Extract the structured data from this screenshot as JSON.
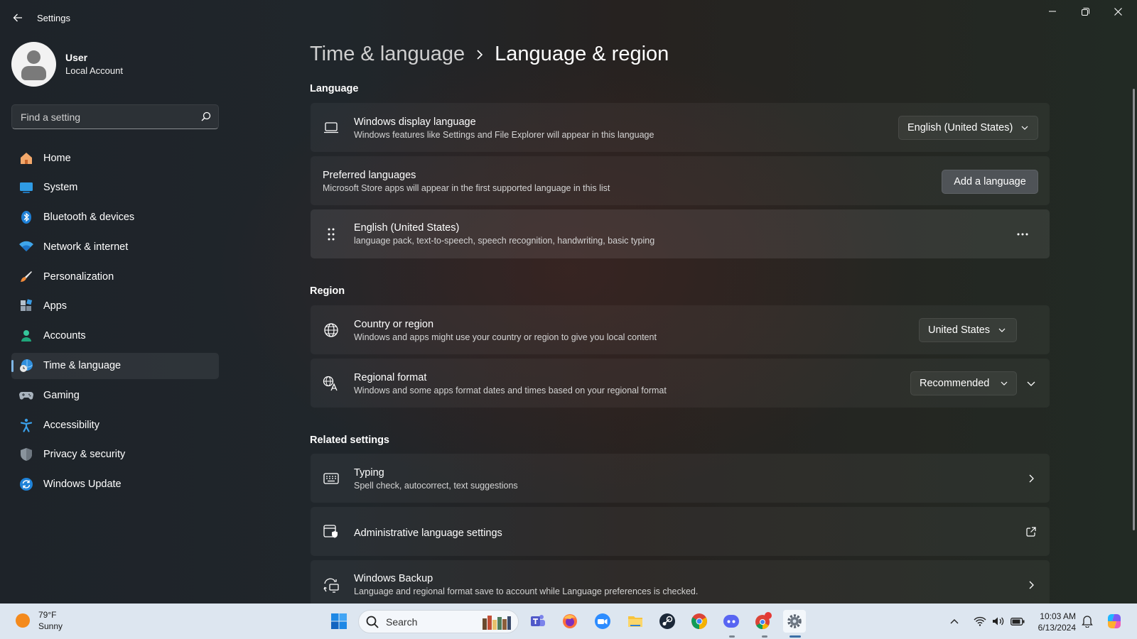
{
  "window": {
    "title": "Settings"
  },
  "profile": {
    "name": "User",
    "account_type": "Local Account"
  },
  "search": {
    "placeholder": "Find a setting"
  },
  "nav": {
    "items": [
      {
        "label": "Home",
        "icon": "home-icon"
      },
      {
        "label": "System",
        "icon": "system-icon"
      },
      {
        "label": "Bluetooth & devices",
        "icon": "bluetooth-icon"
      },
      {
        "label": "Network & internet",
        "icon": "wifi-icon"
      },
      {
        "label": "Personalization",
        "icon": "brush-icon"
      },
      {
        "label": "Apps",
        "icon": "apps-icon"
      },
      {
        "label": "Accounts",
        "icon": "accounts-icon"
      },
      {
        "label": "Time & language",
        "icon": "globe-clock-icon",
        "selected": true
      },
      {
        "label": "Gaming",
        "icon": "gamepad-icon"
      },
      {
        "label": "Accessibility",
        "icon": "accessibility-icon"
      },
      {
        "label": "Privacy & security",
        "icon": "shield-icon"
      },
      {
        "label": "Windows Update",
        "icon": "update-icon"
      }
    ]
  },
  "breadcrumb": {
    "parent": "Time & language",
    "current": "Language & region"
  },
  "language": {
    "title": "Language",
    "display_language": {
      "title": "Windows display language",
      "desc": "Windows features like Settings and File Explorer will appear in this language",
      "value": "English (United States)"
    },
    "preferred": {
      "title": "Preferred languages",
      "desc": "Microsoft Store apps will appear in the first supported language in this list",
      "button": "Add a language"
    },
    "installed": {
      "title": "English (United States)",
      "desc": "language pack, text-to-speech, speech recognition, handwriting, basic typing"
    }
  },
  "region": {
    "title": "Region",
    "country": {
      "title": "Country or region",
      "desc": "Windows and apps might use your country or region to give you local content",
      "value": "United States"
    },
    "format": {
      "title": "Regional format",
      "desc": "Windows and some apps format dates and times based on your regional format",
      "value": "Recommended"
    }
  },
  "related": {
    "title": "Related settings",
    "typing": {
      "title": "Typing",
      "desc": "Spell check, autocorrect, text suggestions"
    },
    "admin": {
      "title": "Administrative language settings"
    },
    "backup": {
      "title": "Windows Backup",
      "desc": "Language and regional format save to account while Language preferences is checked."
    }
  },
  "taskbar": {
    "weather": {
      "temp": "79°F",
      "condition": "Sunny"
    },
    "search_label": "Search",
    "time": "10:03 AM",
    "date": "6/13/2024",
    "apps": [
      "start-icon",
      "teams-icon",
      "firefox-icon",
      "zoom-icon",
      "file-explorer-icon",
      "steam-icon",
      "chrome-icon",
      "discord-icon",
      "chrome-profile-icon",
      "settings-icon"
    ]
  },
  "colors": {
    "accent": "#7fb6e6",
    "taskbar": "#dde6f0"
  }
}
